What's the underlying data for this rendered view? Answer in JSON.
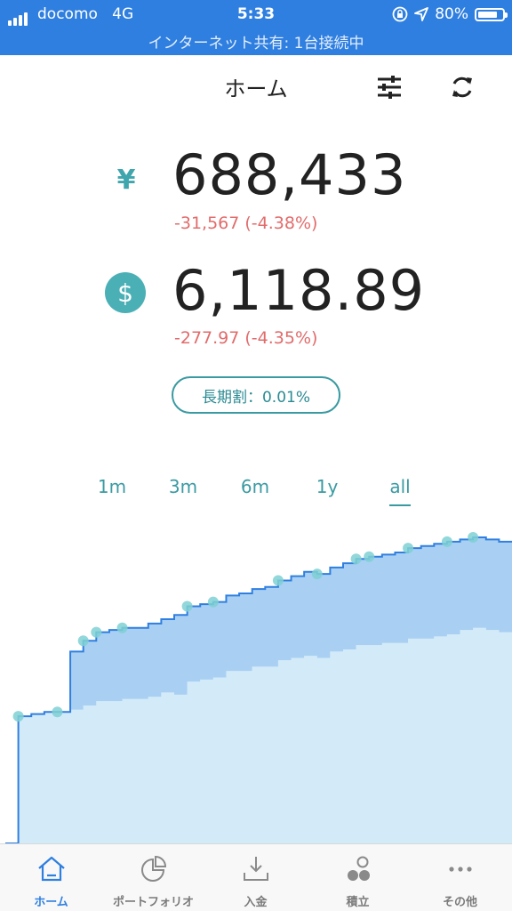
{
  "status_bar": {
    "carrier": "docomo",
    "network": "4G",
    "time": "5:33",
    "battery": "80%",
    "battery_level": 0.8,
    "hotspot_text": "インターネット共有: 1台接続中"
  },
  "header": {
    "title": "ホーム",
    "settings_icon": "sliders-icon",
    "refresh_icon": "refresh-icon"
  },
  "balances": {
    "jpy": {
      "symbol": "¥",
      "amount": "688,433",
      "change": "-31,567 (-4.38%)"
    },
    "usd": {
      "symbol": "$",
      "amount": "6,118.89",
      "change": "-277.97 (-4.35%)"
    }
  },
  "long_term_discount": "長期割：0.01%",
  "period_tabs": [
    {
      "label": "1m",
      "active": false
    },
    {
      "label": "3m",
      "active": false
    },
    {
      "label": "6m",
      "active": false
    },
    {
      "label": "1y",
      "active": false
    },
    {
      "label": "all",
      "active": true
    }
  ],
  "colors": {
    "accent": "#3a9aa2",
    "status_bar": "#2f7fe0",
    "negative": "#e26b6b",
    "chart_fill": "#d3eaf9",
    "chart_line": "#2f7fe0"
  },
  "chart_data": {
    "type": "area",
    "title": "",
    "xlabel": "",
    "ylabel": "",
    "grid": false,
    "series": [
      {
        "values": [
          0,
          59,
          60,
          61,
          61,
          62,
          64,
          66,
          66,
          67,
          67,
          68,
          70,
          69,
          75,
          76,
          77,
          80,
          80,
          82,
          82,
          85,
          86,
          87,
          86,
          89,
          90,
          92,
          92,
          93,
          93,
          95,
          95,
          96,
          97,
          99,
          100,
          99,
          98,
          98
        ]
      },
      {
        "values": [
          0,
          59,
          60,
          61,
          61,
          89,
          94,
          98,
          99,
          100,
          100,
          102,
          104,
          106,
          110,
          111,
          112,
          115,
          116,
          118,
          119,
          122,
          124,
          126,
          125,
          128,
          130,
          132,
          133,
          134,
          135,
          137,
          138,
          139,
          140,
          141,
          142,
          141,
          140,
          140
        ]
      }
    ],
    "markers": [
      1,
      4,
      6,
      7,
      9,
      14,
      16,
      21,
      24,
      27,
      28,
      31,
      34,
      36
    ]
  },
  "bottom_nav": [
    {
      "label": "ホーム",
      "icon": "home-icon",
      "active": true
    },
    {
      "label": "ポートフォリオ",
      "icon": "portfolio-pie-icon",
      "active": false
    },
    {
      "label": "入金",
      "icon": "deposit-download-icon",
      "active": false
    },
    {
      "label": "積立",
      "icon": "savings-dots-icon",
      "active": false
    },
    {
      "label": "その他",
      "icon": "more-icon",
      "active": false
    }
  ]
}
